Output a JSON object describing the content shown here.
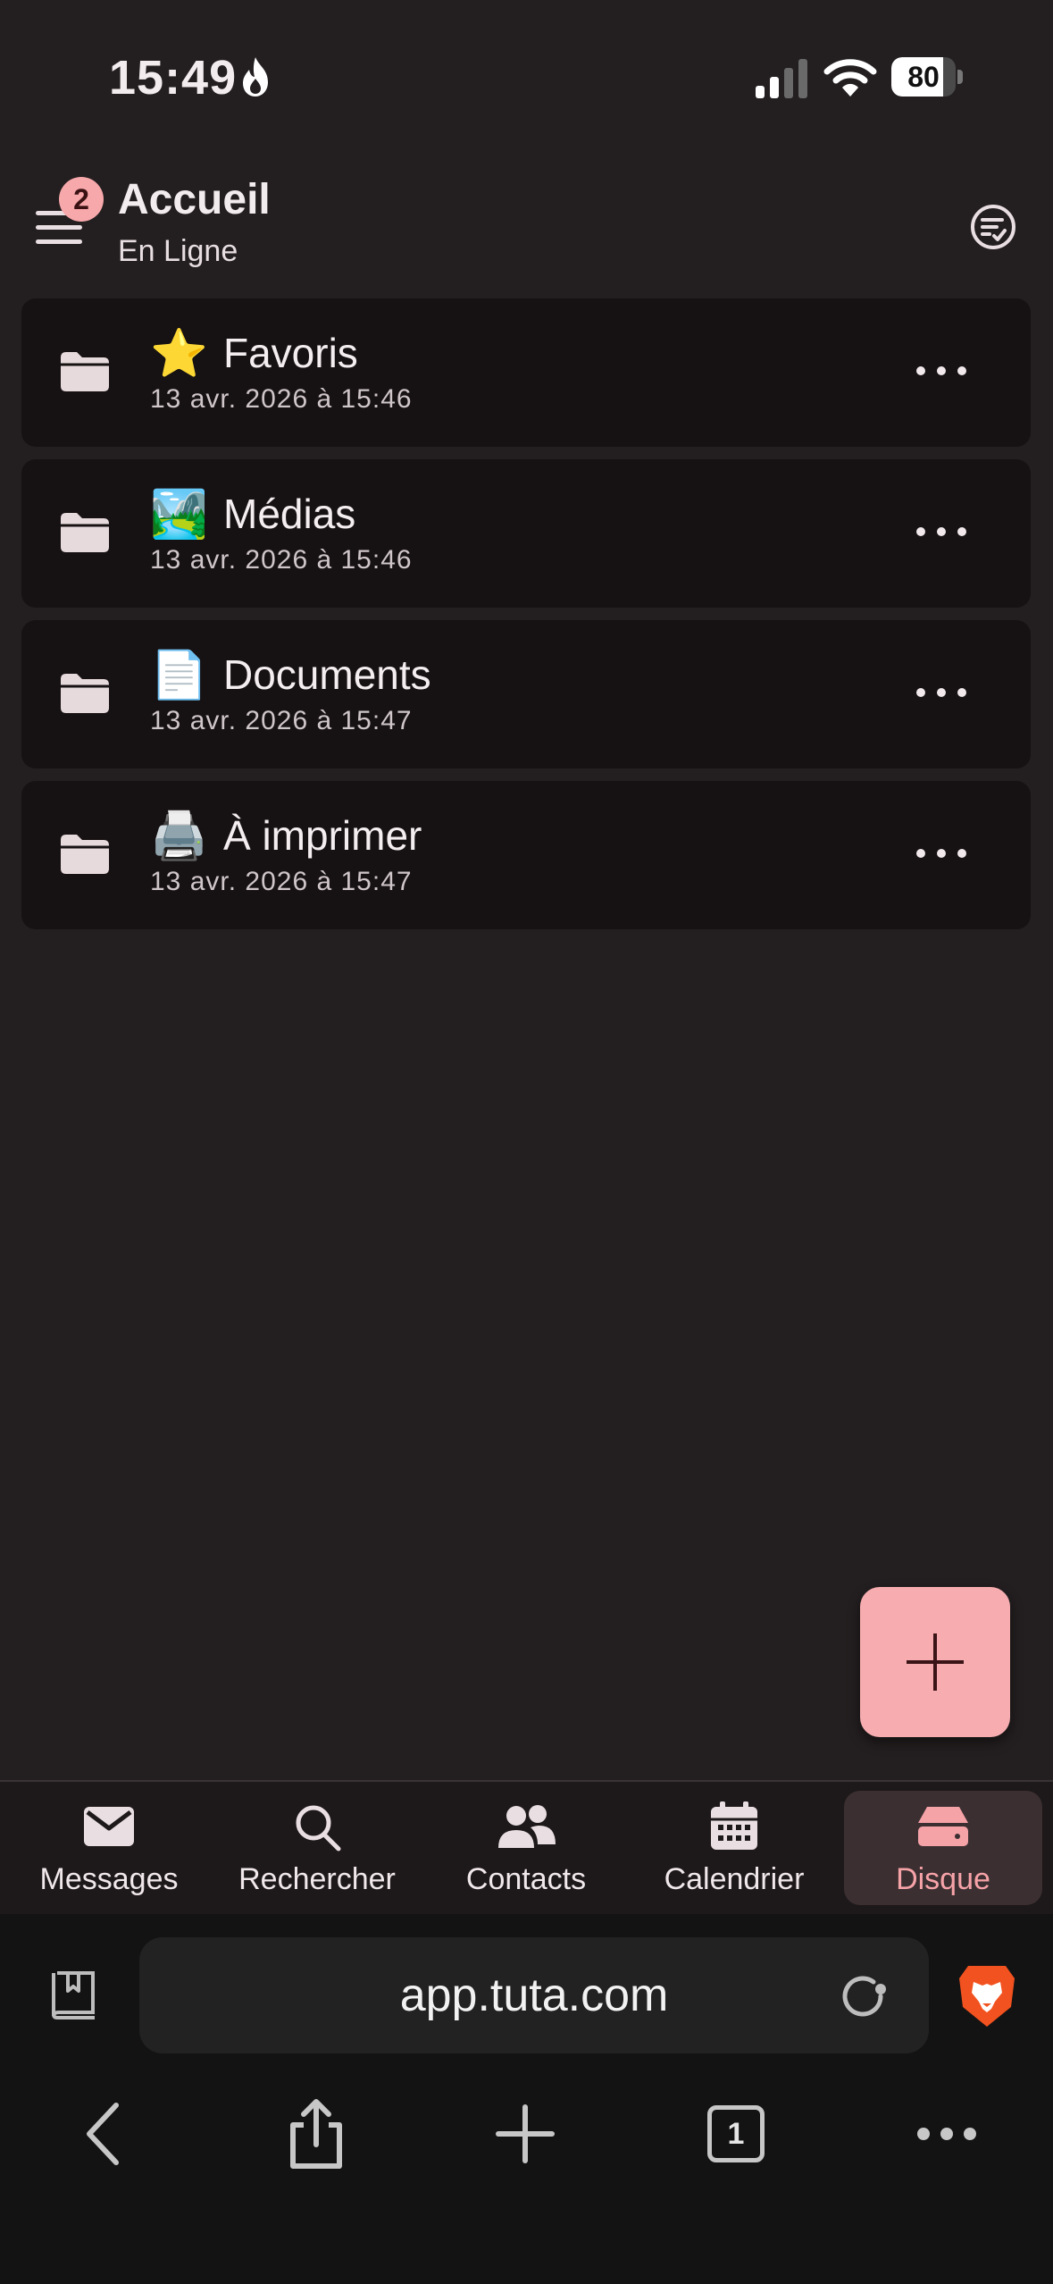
{
  "status_bar": {
    "time": "15:49",
    "battery_level": "80",
    "battery_fraction": 0.8,
    "icons": [
      "flame-icon",
      "signal-icon",
      "wifi-icon",
      "battery-icon"
    ]
  },
  "header": {
    "notification_badge": "2",
    "title": "Accueil",
    "subtitle": "En Ligne",
    "icons": [
      "menu-icon",
      "filter-check-icon"
    ]
  },
  "folders": [
    {
      "emoji": "⭐",
      "name": "Favoris",
      "date": "13 avr. 2026 à 15:46"
    },
    {
      "emoji": "🏞️",
      "name": "Médias",
      "date": "13 avr. 2026 à 15:46"
    },
    {
      "emoji": "📄",
      "name": "Documents",
      "date": "13 avr. 2026 à 15:47"
    },
    {
      "emoji": "🖨️",
      "name": "À imprimer",
      "date": "13 avr. 2026 à 15:47"
    }
  ],
  "fab": {
    "icon": "plus-icon"
  },
  "bottom_nav": [
    {
      "label": "Messages",
      "icon": "mail-icon",
      "active": false
    },
    {
      "label": "Rechercher",
      "icon": "search-icon",
      "active": false
    },
    {
      "label": "Contacts",
      "icon": "contacts-icon",
      "active": false
    },
    {
      "label": "Calendrier",
      "icon": "calendar-icon",
      "active": false
    },
    {
      "label": "Disque",
      "icon": "drive-icon",
      "active": true
    }
  ],
  "browser": {
    "url": "app.tuta.com",
    "open_tabs": "1",
    "icons": [
      "bookmarks-icon",
      "reload-icon",
      "brave-lion-icon",
      "back-icon",
      "share-icon",
      "new-tab-icon",
      "tabs-icon",
      "more-icon"
    ]
  },
  "colors": {
    "background": "#231e1f",
    "card": "#161112",
    "accent": "#f7adb0",
    "active_nav_bg": "#3b2f31",
    "active_nav_text": "#f6a3a8"
  }
}
